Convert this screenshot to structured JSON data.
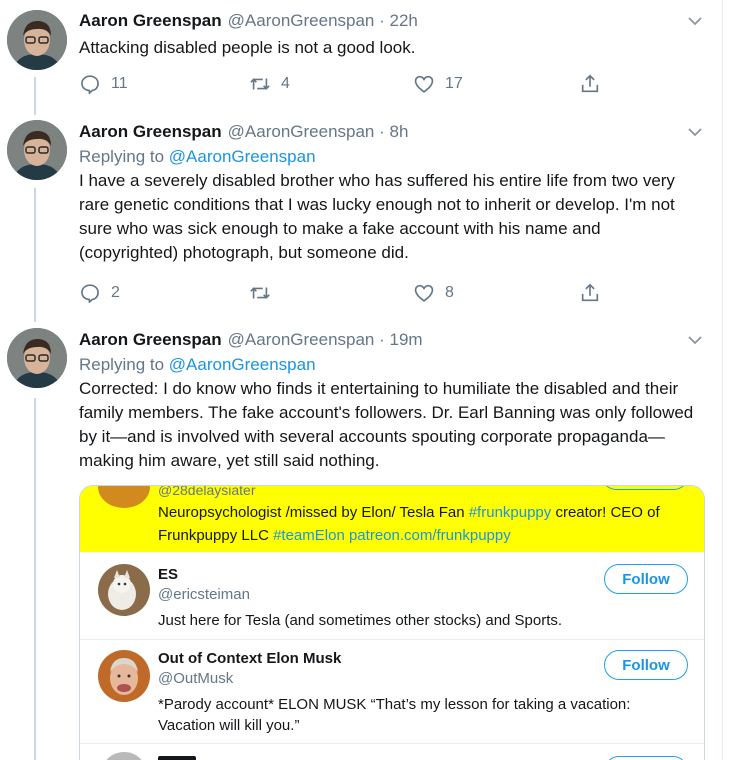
{
  "tweets": [
    {
      "name": "Aaron Greenspan",
      "handle": "@AaronGreenspan",
      "time": "· 22h",
      "text": "Attacking disabled people is not a good look.",
      "replies": "11",
      "retweets": "4",
      "likes": "17"
    },
    {
      "name": "Aaron Greenspan",
      "handle": "@AaronGreenspan",
      "time": "· 8h",
      "replying_label": "Replying to",
      "replying_to": "@AaronGreenspan",
      "text": "I have a severely disabled brother who has suffered his entire life from two very rare genetic conditions that I was lucky enough not to inherit or develop. I'm not sure who was sick enough to make a fake account with his name and (copyrighted) photograph, but someone did.",
      "replies": "2",
      "retweets": "",
      "likes": "8"
    },
    {
      "name": "Aaron Greenspan",
      "handle": "@AaronGreenspan",
      "time": "· 19m",
      "replying_label": "Replying to",
      "replying_to": "@AaronGreenspan",
      "text": "Corrected: I do know who finds it entertaining to humiliate the disabled and their family members. The fake account's followers. Dr. Earl Banning was only followed by it—and is involved with several accounts spouting corporate propaganda—making him aware, yet still said nothing."
    }
  ],
  "card": {
    "highlighted": {
      "handle_partial": "@28delaysiater",
      "bio_plain_1": "Neuropsychologist /missed by Elon/ Tesla Fan ",
      "bio_tag_1": "#frunkpuppy",
      "bio_plain_2": " creator! CEO of Frunkpuppy LLC ",
      "bio_tag_2": "#teamElon",
      "bio_plain_3": " ",
      "bio_link": "patreon.com/frunkpuppy"
    },
    "users": [
      {
        "name": "ES",
        "handle": "@ericsteiman",
        "bio": "Just here for Tesla (and sometimes other stocks) and Sports.",
        "follow_label": "Follow"
      },
      {
        "name": "Out of Context Elon Musk",
        "handle": "@OutMusk",
        "bio": "*Parody account* ELON MUSK “That’s my lesson for taking a vacation: Vacation will kill you.”",
        "follow_label": "Follow"
      }
    ]
  },
  "colors": {
    "text": "#14171a",
    "secondary": "#657786",
    "link": "#1b95e0",
    "accent": "#1da1f2",
    "highlight": "#ffff00",
    "thread_line": "#ccd6dd"
  },
  "icons": {
    "reply": "reply-icon",
    "retweet": "retweet-icon",
    "like": "like-icon",
    "share": "share-icon",
    "caret": "chevron-down-icon"
  }
}
